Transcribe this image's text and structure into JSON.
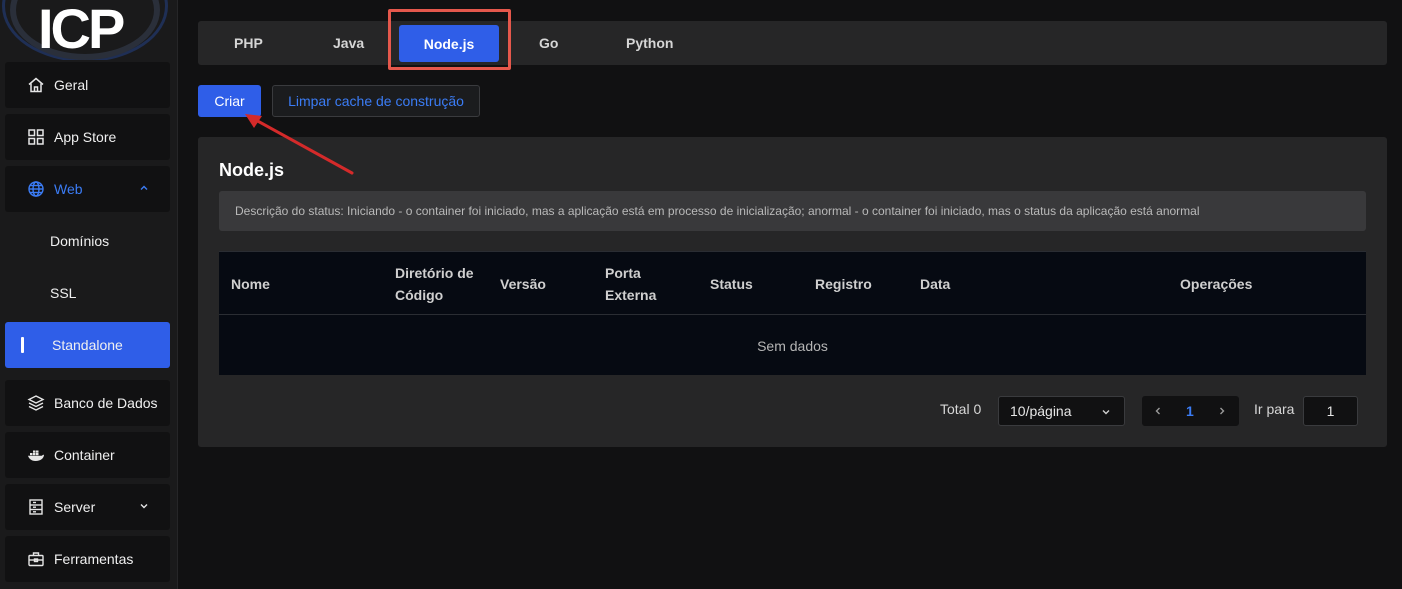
{
  "logo": {
    "text": "ICP"
  },
  "sidebar": {
    "items": [
      {
        "label": "Geral",
        "icon": "home-icon"
      },
      {
        "label": "App Store",
        "icon": "grid-icon"
      },
      {
        "label": "Web",
        "icon": "globe-icon",
        "expanded": true
      },
      {
        "label": "Domínios"
      },
      {
        "label": "SSL"
      },
      {
        "label": "Standalone",
        "active": true
      },
      {
        "label": "Banco de Dados",
        "icon": "layers-icon"
      },
      {
        "label": "Container",
        "icon": "docker-icon"
      },
      {
        "label": "Server",
        "icon": "server-icon"
      },
      {
        "label": "Ferramentas",
        "icon": "toolbox-icon"
      }
    ]
  },
  "tabs": [
    {
      "label": "PHP"
    },
    {
      "label": "Java"
    },
    {
      "label": "Node.js",
      "active": true
    },
    {
      "label": "Go"
    },
    {
      "label": "Python"
    }
  ],
  "toolbar": {
    "create_label": "Criar",
    "clear_cache_label": "Limpar cache de construção"
  },
  "card": {
    "title": "Node.js",
    "status_description": "Descrição do status: Iniciando - o container foi iniciado, mas a aplicação está em processo de inicialização; anormal - o container foi iniciado, mas o status da aplicação está anormal"
  },
  "table": {
    "columns": [
      "Nome",
      "Diretório de Código",
      "Versão",
      "Porta Externa",
      "Status",
      "Registro",
      "Data",
      "Operações"
    ],
    "empty_text": "Sem dados"
  },
  "pagination": {
    "total_label": "Total 0",
    "page_size": "10/página",
    "current_page": "1",
    "goto_label": "Ir para",
    "goto_value": "1"
  },
  "colors": {
    "accent": "#2f5ee8",
    "annotation": "#e5584c",
    "arrow": "#d42a2a"
  }
}
